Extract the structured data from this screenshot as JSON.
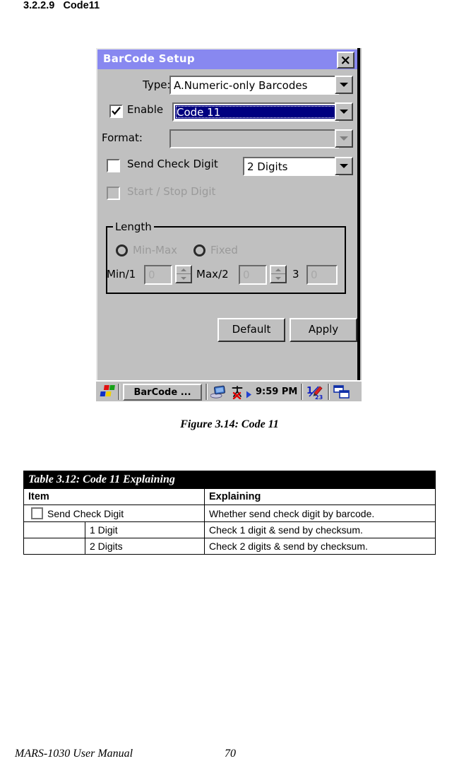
{
  "document": {
    "section_number": "3.2.2.9",
    "section_title": "Code11",
    "figure_caption": "Figure 3.14: Code 11",
    "footer_left": "MARS-1030 User Manual",
    "footer_page": "70"
  },
  "dialog": {
    "title": "BarCode Setup",
    "close_label": "×",
    "titlebar_color": "#8888f0",
    "face_color": "#c0c0c0",
    "selection_color": "#000080",
    "type": {
      "label": "Type:",
      "value": "A.Numeric-only Barcodes"
    },
    "enable": {
      "label": "Enable",
      "checked": true,
      "value": "Code 11"
    },
    "format": {
      "label": "Format:",
      "value": "",
      "disabled": true
    },
    "send_check_digit": {
      "label": "Send Check Digit",
      "checked": false,
      "value": "2 Digits"
    },
    "start_stop_digit": {
      "label": "Start / Stop Digit",
      "checked": false,
      "disabled": true
    },
    "length": {
      "title": "Length",
      "radio_min_max": "Min-Max",
      "radio_fixed": "Fixed",
      "min_label": "Min/1",
      "min_value": "0",
      "max_label": "Max/2",
      "max_value": "0",
      "third_label": "3",
      "third_value": "0"
    },
    "buttons": {
      "default_label": "Default",
      "apply_label": "Apply"
    },
    "taskbar": {
      "task_label": "BarCode ...",
      "clock": "9:59 PM"
    }
  },
  "table": {
    "title": "Table 3.12: Code 11 Explaining",
    "headers": [
      "Item",
      "Explaining"
    ],
    "rows": [
      {
        "item": "Send Check Digit",
        "has_checkbox": true,
        "sub": "",
        "explaining": "Whether send check digit by barcode."
      },
      {
        "item": "",
        "has_checkbox": false,
        "sub": "1 Digit",
        "explaining": "Check 1 digit & send by checksum."
      },
      {
        "item": "",
        "has_checkbox": false,
        "sub": "2 Digits",
        "explaining": "Check 2 digits & send by checksum."
      }
    ]
  }
}
